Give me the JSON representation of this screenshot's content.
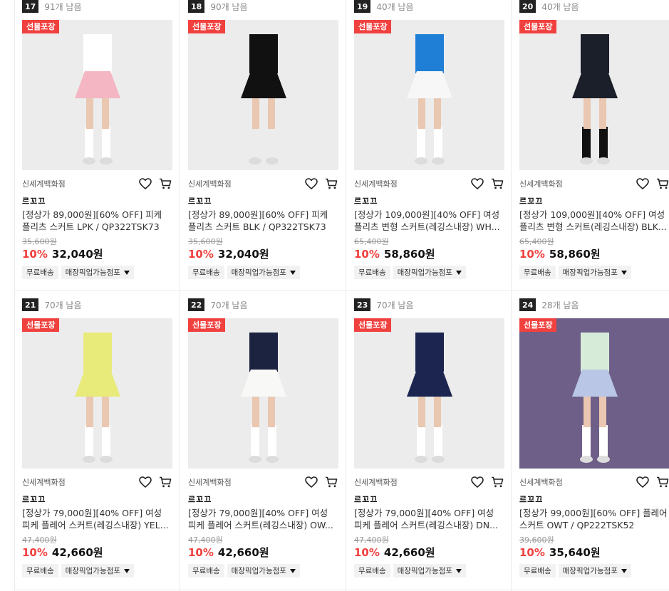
{
  "products": [
    {
      "rank": "17",
      "stock": "91개 남음",
      "badge": "선물포장",
      "store": "신세계백화점",
      "brand": "르꼬끄",
      "name": "[정상가 89,000원][60% OFF] 피케 플리츠 스커트 LPK / QP322TSK73",
      "original_price": "35,600원",
      "discount": "10%",
      "price": "32,040원",
      "tag_shipping": "무료배송",
      "tag_pickup": "매장픽업가능점포",
      "colors": {
        "skirt": "#f4b6c2",
        "top": "#ffffff",
        "bg": "#ececec",
        "sock": "#ffffff"
      }
    },
    {
      "rank": "18",
      "stock": "90개 남음",
      "badge": "선물포장",
      "store": "신세계백화점",
      "brand": "르꼬끄",
      "name": "[정상가 89,000원][60% OFF] 피케 플리츠 스커트 BLK / QP322TSK73",
      "original_price": "35,600원",
      "discount": "10%",
      "price": "32,040원",
      "tag_shipping": "무료배송",
      "tag_pickup": "매장픽업가능점포",
      "colors": {
        "skirt": "#111111",
        "top": "#111111",
        "bg": "#ececec",
        "sock": "#ececec"
      }
    },
    {
      "rank": "19",
      "stock": "40개 남음",
      "badge": "선물포장",
      "store": "신세계백화점",
      "brand": "르꼬끄",
      "name": "[정상가 109,000원][40% OFF] 여성 플리츠 변형 스커트(레깅스내장) WH...",
      "original_price": "65,400원",
      "discount": "10%",
      "price": "58,860원",
      "tag_shipping": "무료배송",
      "tag_pickup": "매장픽업가능점포",
      "colors": {
        "skirt": "#f7f7f7",
        "top": "#1f7fd6",
        "bg": "#ececec",
        "sock": "#ffffff"
      }
    },
    {
      "rank": "20",
      "stock": "40개 남음",
      "badge": "선물포장",
      "store": "신세계백화점",
      "brand": "르꼬끄",
      "name": "[정상가 109,000원][40% OFF] 여성 플리츠 변형 스커트(레깅스내장) BLK...",
      "original_price": "65,400원",
      "discount": "10%",
      "price": "58,860원",
      "tag_shipping": "무료배송",
      "tag_pickup": "매장픽업가능점포",
      "colors": {
        "skirt": "#1b1f2a",
        "top": "#1b1f2a",
        "bg": "#ececec",
        "sock": "#111111"
      }
    },
    {
      "rank": "21",
      "stock": "70개 남음",
      "badge": "선물포장",
      "store": "신세계백화점",
      "brand": "르꼬끄",
      "name": "[정상가 79,000원][40% OFF] 여성 피케 플레어 스커트(레깅스내장) YEL...",
      "original_price": "47,400원",
      "discount": "10%",
      "price": "42,660원",
      "tag_shipping": "무료배송",
      "tag_pickup": "매장픽업가능점포",
      "colors": {
        "skirt": "#e8ea7a",
        "top": "#e8ea7a",
        "bg": "#ececec",
        "sock": "#ffffff"
      }
    },
    {
      "rank": "22",
      "stock": "70개 남음",
      "badge": "선물포장",
      "store": "신세계백화점",
      "brand": "르꼬끄",
      "name": "[정상가 79,000원][40% OFF] 여성 피케 플레어 스커트(레깅스내장) OW...",
      "original_price": "47,400원",
      "discount": "10%",
      "price": "42,660원",
      "tag_shipping": "무료배송",
      "tag_pickup": "매장픽업가능점포",
      "colors": {
        "skirt": "#f8f8f6",
        "top": "#1b2340",
        "bg": "#ececec",
        "sock": "#ffffff"
      }
    },
    {
      "rank": "23",
      "stock": "70개 남음",
      "badge": "선물포장",
      "store": "신세계백화점",
      "brand": "르꼬끄",
      "name": "[정상가 79,000원][40% OFF] 여성 피케 플레어 스커트(레깅스내장) DN...",
      "original_price": "47,400원",
      "discount": "10%",
      "price": "42,660원",
      "tag_shipping": "무료배송",
      "tag_pickup": "매장픽업가능점포",
      "colors": {
        "skirt": "#1c2550",
        "top": "#1c2550",
        "bg": "#ececec",
        "sock": "#ffffff"
      }
    },
    {
      "rank": "24",
      "stock": "28개 남음",
      "badge": "선물포장",
      "store": "신세계백화점",
      "brand": "르꼬끄",
      "name": "[정상가 99,000원][60% OFF] 플레어 스커트 OWT / QP222TSK52",
      "original_price": "39,600원",
      "discount": "10%",
      "price": "35,640원",
      "tag_shipping": "무료배송",
      "tag_pickup": "매장픽업가능점포",
      "colors": {
        "skirt": "#b9c6e6",
        "top": "#d6ecd9",
        "bg": "#6e5f88",
        "sock": "#ffffff"
      }
    }
  ]
}
